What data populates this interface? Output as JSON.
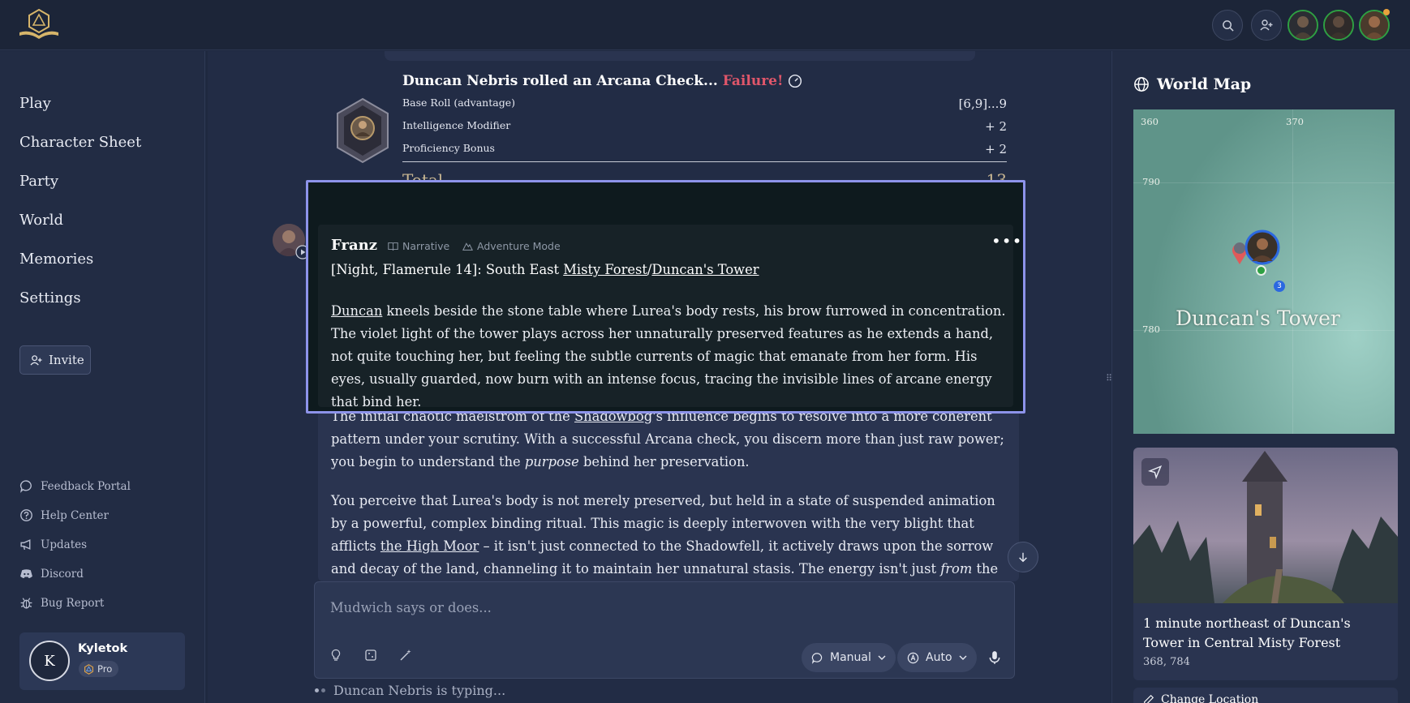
{
  "sidebar": {
    "items": [
      {
        "label": "Play"
      },
      {
        "label": "Character Sheet"
      },
      {
        "label": "Party"
      },
      {
        "label": "World"
      },
      {
        "label": "Memories"
      },
      {
        "label": "Settings"
      }
    ],
    "invite_label": "Invite",
    "footer_links": [
      {
        "label": "Feedback Portal",
        "icon": "chat-icon"
      },
      {
        "label": "Help Center",
        "icon": "help-icon"
      },
      {
        "label": "Updates",
        "icon": "megaphone-icon"
      },
      {
        "label": "Discord",
        "icon": "discord-icon"
      },
      {
        "label": "Bug Report",
        "icon": "bug-icon"
      }
    ],
    "user": {
      "initial": "K",
      "name": "Kyletok",
      "badge": "Pro"
    }
  },
  "roll": {
    "title": "Duncan Nebris rolled an Arcana Check...",
    "result": "Failure!",
    "rows": [
      {
        "label": "Base Roll (advantage)",
        "value": "[6,9]...9"
      },
      {
        "label": "Intelligence Modifier",
        "value": "+ 2"
      },
      {
        "label": "Proficiency Bonus",
        "value": "+ 2"
      }
    ],
    "total_label": "Total",
    "total_value": "13"
  },
  "highlight": {
    "name": "Franz",
    "tag_narrative": "Narrative",
    "tag_mode": "Adventure Mode",
    "location_prefix": "[Night, Flamerule 14]: South East ",
    "location_link1": "Misty Forest",
    "location_sep": "/",
    "location_link2": "Duncan's Tower",
    "para_link": "Duncan",
    "para_text": " kneels beside the stone table where Lurea's body rests, his brow furrowed in concentration. The violet light of the tower plays across her unnaturally preserved features as he extends a hand, not quite touching her, but feeling the subtle currents of magic that emanate from her form. His eyes, usually guarded, now burn with an intense focus, tracing the invisible lines of arcane energy that bind her."
  },
  "narration": {
    "p1_a": "The initial chaotic maelstrom of the ",
    "p1_link": "Shadowbog",
    "p1_b": "'s influence begins to resolve into a more coherent pattern under your scrutiny. With a successful Arcana check, you discern more than just raw power; you begin to understand the ",
    "p1_em": "purpose",
    "p1_c": " behind her preservation.",
    "p2_a": "You perceive that Lurea's body is not merely preserved, but held in a state of suspended animation by a powerful, complex binding ritual. This magic is deeply interwoven with the very blight that afflicts ",
    "p2_link": "the High Moor",
    "p2_b": " – it isn't just connected to the Shadowfell, it actively draws upon the sorrow and decay of the land, channeling it to maintain her unnatural stasis. The energy isn't just ",
    "p2_em": "from",
    "p2_c": " the Shadowfell; it feels as if Lurea"
  },
  "input": {
    "placeholder": "Mudwich says or does...",
    "mode1": "Manual",
    "mode2": "Auto"
  },
  "typing": "Duncan Nebris is typing...",
  "world_map": {
    "title": "World Map",
    "labels_x": [
      "360",
      "370"
    ],
    "labels_y": [
      "790",
      "780"
    ],
    "place": "Duncan's Tower",
    "marker_count": "3",
    "location_title": "1 minute northeast of Duncan's Tower in Central Misty Forest",
    "coords": "368, 784",
    "change_location": "Change Location"
  },
  "colors": {
    "failure": "#e0566a",
    "highlight_border": "#8d93ea",
    "online": "#2ea043"
  }
}
